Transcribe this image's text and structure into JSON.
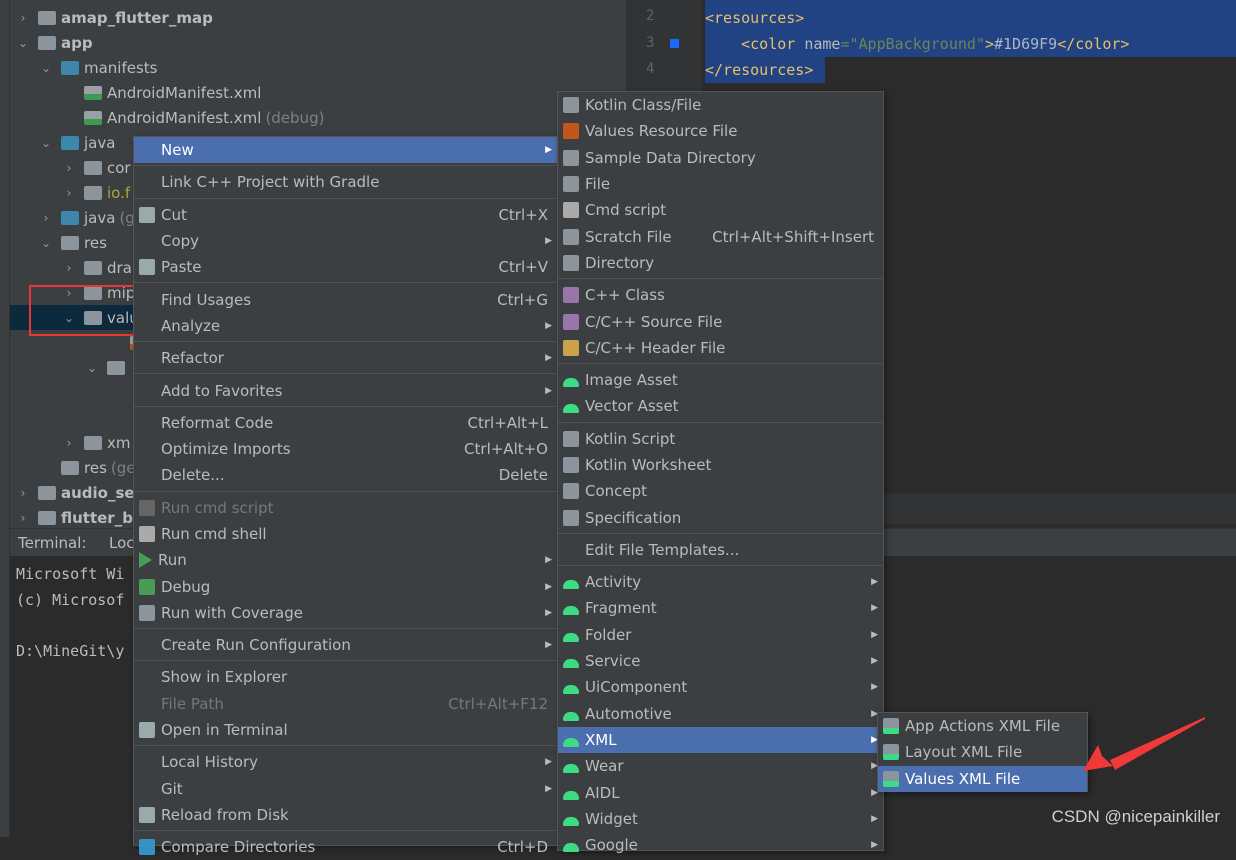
{
  "tree": [
    {
      "label": "amap_flutter_map",
      "level": 1,
      "chev": ">",
      "icon": "module",
      "bold": true
    },
    {
      "label": "app",
      "level": 1,
      "chev": "v",
      "icon": "module",
      "bold": true
    },
    {
      "label": "manifests",
      "level": 2,
      "chev": "v",
      "icon": "folder-blue"
    },
    {
      "label": "AndroidManifest.xml",
      "level": 3,
      "chev": "",
      "icon": "manifest"
    },
    {
      "label": "AndroidManifest.xml",
      "suffix": "(debug)",
      "level": 3,
      "chev": "",
      "icon": "manifest"
    },
    {
      "label": "java",
      "level": 2,
      "chev": "v",
      "icon": "folder-blue"
    },
    {
      "label": "cor",
      "level": 3,
      "chev": ">",
      "icon": "package"
    },
    {
      "label": "io.f",
      "level": 3,
      "chev": ">",
      "icon": "package",
      "olive": true
    },
    {
      "label": "java",
      "suffix": "(g",
      "level": 2,
      "chev": ">",
      "icon": "folder-blue"
    },
    {
      "label": "res",
      "level": 2,
      "chev": "v",
      "icon": "folder-grey"
    },
    {
      "label": "dra",
      "level": 3,
      "chev": ">",
      "icon": "package"
    },
    {
      "label": "mip",
      "level": 3,
      "chev": ">",
      "icon": "package"
    },
    {
      "label": "valu",
      "level": 3,
      "chev": "v",
      "icon": "package",
      "selected": true
    },
    {
      "label": "",
      "level": 5,
      "chev": "",
      "icon": "values"
    },
    {
      "label": "",
      "level": 4,
      "chev": "v",
      "icon": "package"
    },
    {
      "label": "",
      "level": 0,
      "chev": "",
      "icon": ""
    },
    {
      "label": "",
      "level": 0,
      "chev": "",
      "icon": ""
    },
    {
      "label": "xm",
      "level": 3,
      "chev": ">",
      "icon": "package"
    },
    {
      "label": "res",
      "suffix": "(ge",
      "level": 2,
      "chev": "",
      "icon": "folder-grey"
    },
    {
      "label": "audio_ses",
      "level": 1,
      "chev": ">",
      "icon": "module",
      "bold": true
    },
    {
      "label": "flutter_bl",
      "level": 1,
      "chev": ">",
      "icon": "module",
      "bold": true
    }
  ],
  "editor": {
    "line_numbers": [
      "2",
      "3",
      "4"
    ],
    "lines": [
      {
        "tag": "<resources>"
      },
      {
        "indent": "    ",
        "open": "<color ",
        "attr": "name",
        "eq": "=",
        "str": "\"AppBackground\"",
        "close": ">",
        "text": "#1D69F9",
        "end": "</color>"
      },
      {
        "tag": "</resources>"
      }
    ],
    "color_swatch": "#1D69F9"
  },
  "terminal": {
    "title": "Terminal:",
    "tab": "Loc",
    "lines": [
      "Microsoft Wi",
      "(c) Microsof",
      "",
      "D:\\MineGit\\y"
    ]
  },
  "context_menu": [
    {
      "label": "New",
      "arrow": true,
      "hl": true
    },
    {
      "sep": true
    },
    {
      "label": "Link C++ Project with Gradle"
    },
    {
      "sep": true
    },
    {
      "label": "Cut",
      "shortcut": "Ctrl+X",
      "icon": "scissors"
    },
    {
      "label": "Copy",
      "arrow": true
    },
    {
      "label": "Paste",
      "shortcut": "Ctrl+V",
      "icon": "clipboard"
    },
    {
      "sep": true
    },
    {
      "label": "Find Usages",
      "shortcut": "Ctrl+G"
    },
    {
      "label": "Analyze",
      "arrow": true
    },
    {
      "sep": true
    },
    {
      "label": "Refactor",
      "arrow": true
    },
    {
      "sep": true
    },
    {
      "label": "Add to Favorites",
      "arrow": true
    },
    {
      "sep": true
    },
    {
      "label": "Reformat Code",
      "shortcut": "Ctrl+Alt+L"
    },
    {
      "label": "Optimize Imports",
      "shortcut": "Ctrl+Alt+O"
    },
    {
      "label": "Delete...",
      "shortcut": "Delete"
    },
    {
      "sep": true
    },
    {
      "label": "Run cmd script",
      "disabled": true,
      "icon": "printer"
    },
    {
      "label": "Run cmd shell",
      "icon": "cmd"
    },
    {
      "label": "Run",
      "arrow": true,
      "icon": "run"
    },
    {
      "label": "Debug",
      "arrow": true,
      "icon": "bug"
    },
    {
      "label": "Run with Coverage",
      "arrow": true,
      "icon": "coverage"
    },
    {
      "sep": true
    },
    {
      "label": "Create Run Configuration",
      "arrow": true
    },
    {
      "sep": true
    },
    {
      "label": "Show in Explorer"
    },
    {
      "label": "File Path",
      "shortcut": "Ctrl+Alt+F12",
      "disabled": true
    },
    {
      "label": "Open in Terminal",
      "icon": "terminal"
    },
    {
      "sep": true
    },
    {
      "label": "Local History",
      "arrow": true
    },
    {
      "label": "Git",
      "arrow": true
    },
    {
      "label": "Reload from Disk",
      "icon": "reload"
    },
    {
      "sep": true
    },
    {
      "label": "Compare Directories",
      "shortcut": "Ctrl+D",
      "icon": "compare"
    }
  ],
  "new_submenu": [
    {
      "label": "Kotlin Class/File",
      "icon": "kotlin"
    },
    {
      "label": "Values Resource File",
      "icon": "values"
    },
    {
      "label": "Sample Data Directory",
      "icon": "folder"
    },
    {
      "label": "File",
      "icon": "file"
    },
    {
      "label": "Cmd script",
      "icon": "cmd"
    },
    {
      "label": "Scratch File",
      "shortcut": "Ctrl+Alt+Shift+Insert",
      "icon": "scratch"
    },
    {
      "label": "Directory",
      "icon": "folder"
    },
    {
      "sep": true
    },
    {
      "label": "C++ Class",
      "icon": "cpp-class"
    },
    {
      "label": "C/C++ Source File",
      "icon": "cpp"
    },
    {
      "label": "C/C++ Header File",
      "icon": "h"
    },
    {
      "sep": true
    },
    {
      "label": "Image Asset",
      "icon": "android"
    },
    {
      "label": "Vector Asset",
      "icon": "android"
    },
    {
      "sep": true
    },
    {
      "label": "Kotlin Script",
      "icon": "kotlin"
    },
    {
      "label": "Kotlin Worksheet",
      "icon": "kotlin"
    },
    {
      "label": "Concept",
      "icon": "file"
    },
    {
      "label": "Specification",
      "icon": "file"
    },
    {
      "sep": true
    },
    {
      "label": "Edit File Templates..."
    },
    {
      "sep": true
    },
    {
      "label": "Activity",
      "arrow": true,
      "icon": "android"
    },
    {
      "label": "Fragment",
      "arrow": true,
      "icon": "android"
    },
    {
      "label": "Folder",
      "arrow": true,
      "icon": "android"
    },
    {
      "label": "Service",
      "arrow": true,
      "icon": "android"
    },
    {
      "label": "UiComponent",
      "arrow": true,
      "icon": "android"
    },
    {
      "label": "Automotive",
      "arrow": true,
      "icon": "android"
    },
    {
      "label": "XML",
      "arrow": true,
      "icon": "android",
      "hl": true
    },
    {
      "label": "Wear",
      "arrow": true,
      "icon": "android"
    },
    {
      "label": "AIDL",
      "arrow": true,
      "icon": "android"
    },
    {
      "label": "Widget",
      "arrow": true,
      "icon": "android"
    },
    {
      "label": "Google",
      "arrow": true,
      "icon": "android"
    }
  ],
  "xml_submenu": [
    {
      "label": "App Actions XML File",
      "icon": "android-file"
    },
    {
      "label": "Layout XML File",
      "icon": "android-file"
    },
    {
      "label": "Values XML File",
      "icon": "android-file",
      "hl": true
    }
  ],
  "watermark": "CSDN @nicepainkiller",
  "colors": {
    "accent": "#4B6EAF",
    "selection": "#214283",
    "annotation": "#E53935"
  }
}
